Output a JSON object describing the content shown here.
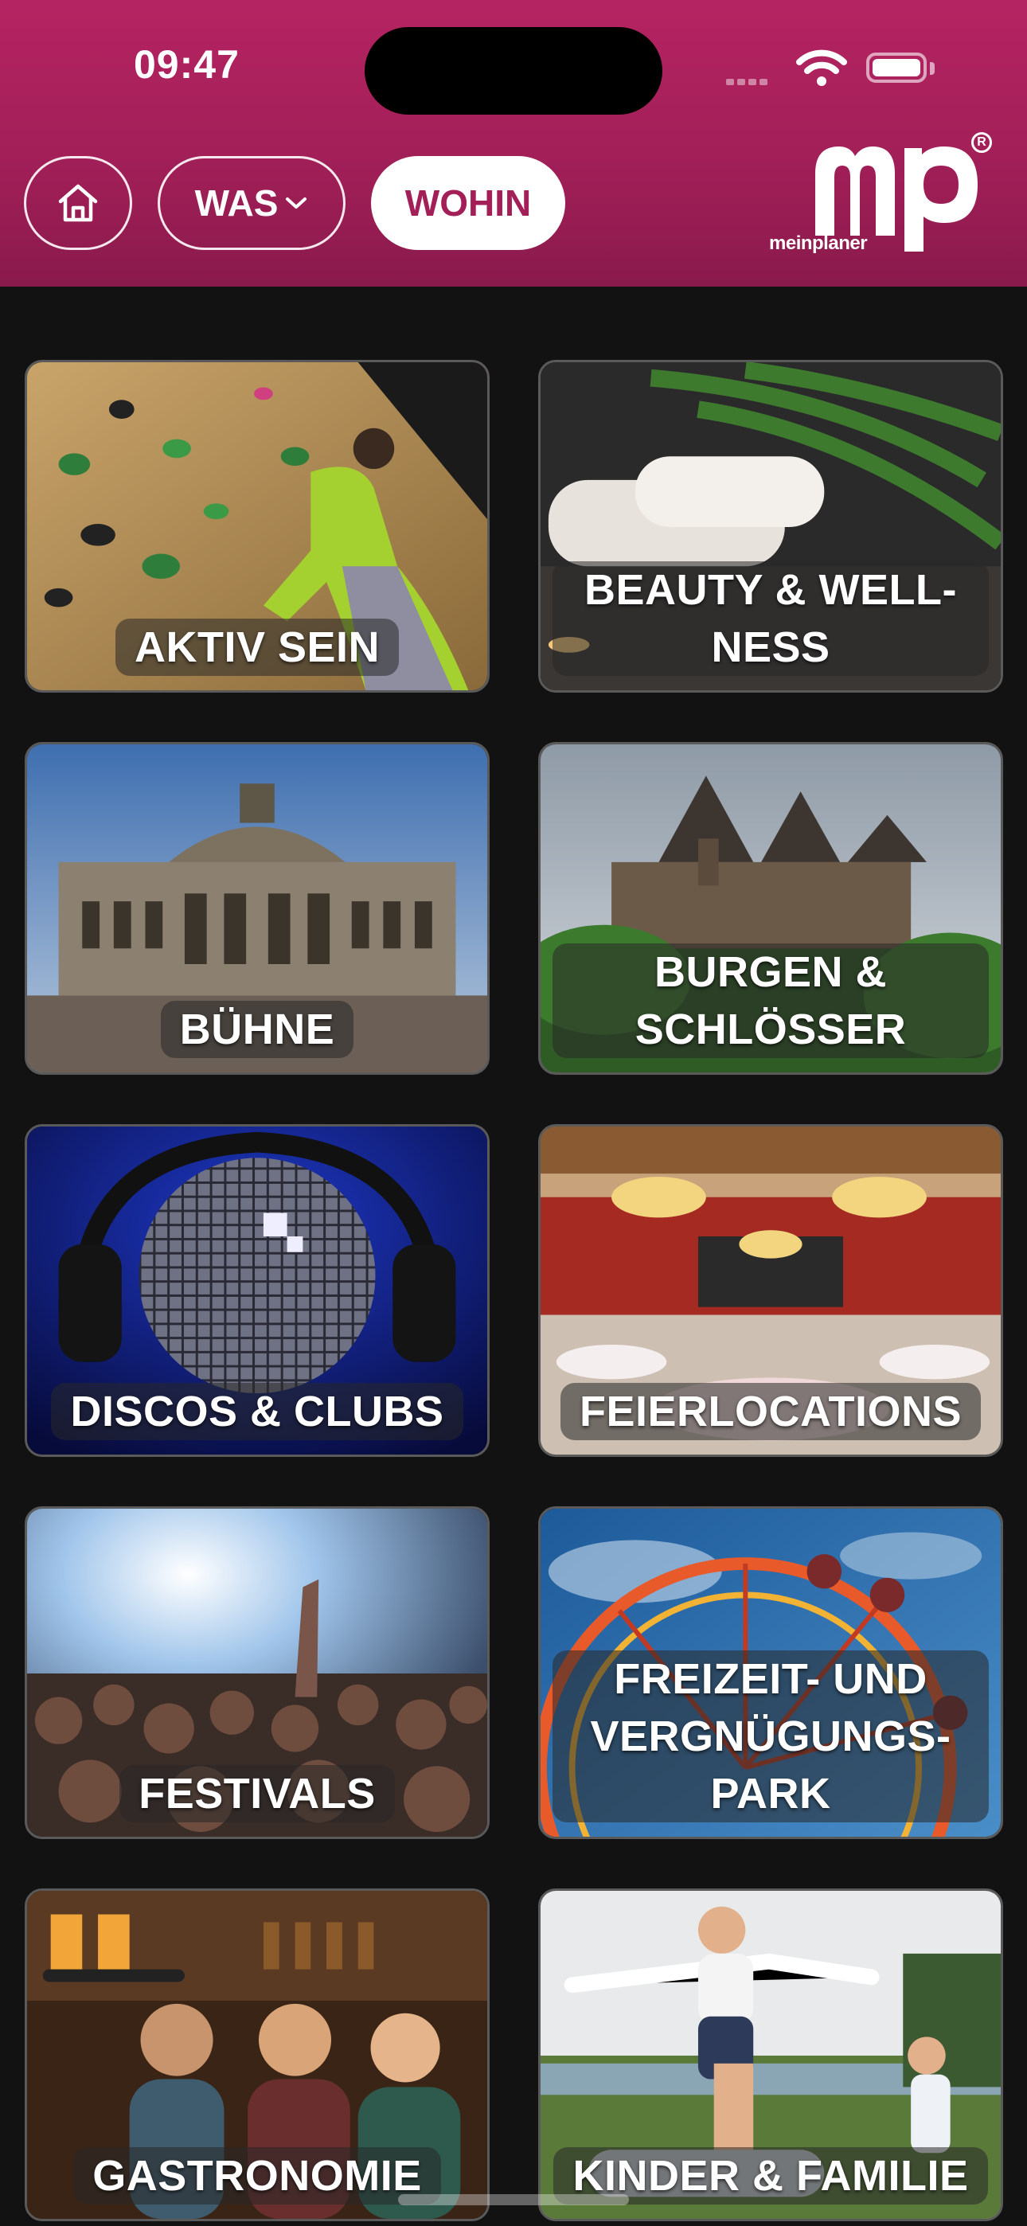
{
  "status_bar": {
    "time": "09:47"
  },
  "nav": {
    "home_icon": "home-icon",
    "was_label": "WAS",
    "was_icon": "chevron-down-icon",
    "wohin_label": "WOHIN"
  },
  "logo": {
    "mark": "mp",
    "reg": "R",
    "text": "meinplaner"
  },
  "colors": {
    "brand": "#a21f58",
    "background": "#121212"
  },
  "categories": [
    {
      "label": "AKTIV SEIN",
      "image": "climbing-wall"
    },
    {
      "label": "BEAUTY & WELL-NESS",
      "image": "spa-towels-palm"
    },
    {
      "label": "BÜHNE",
      "image": "opera-house"
    },
    {
      "label": "BURGEN & SCHLÖSSER",
      "image": "castle"
    },
    {
      "label": "DISCOS & CLUBS",
      "image": "disco-ball-headphones"
    },
    {
      "label": "FEIERLOCATIONS",
      "image": "banquet-hall"
    },
    {
      "label": "FESTIVALS",
      "image": "concert-crowd"
    },
    {
      "label": "FREIZEIT- UND VERGNÜGUNGS-PARK",
      "image": "ferris-wheel"
    },
    {
      "label": "GASTRONOMIE",
      "image": "bar-friends"
    },
    {
      "label": "KINDER & FAMILIE",
      "image": "family-playing"
    }
  ]
}
